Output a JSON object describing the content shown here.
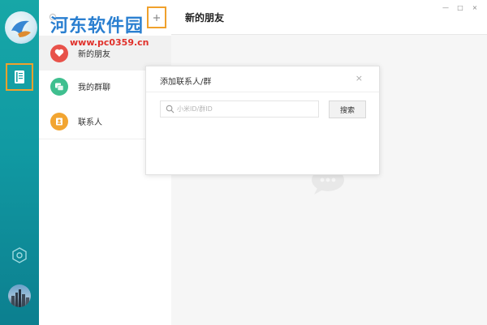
{
  "watermark": {
    "title": "河东软件园",
    "url": "www.pc0359.cn"
  },
  "sidebar": {
    "items": [
      {
        "label": "新的朋友",
        "icon": "heart-icon",
        "color": "#e8524a"
      },
      {
        "label": "我的群聊",
        "icon": "group-chat-icon",
        "color": "#3fbf8f"
      },
      {
        "label": "联系人",
        "icon": "contact-card-icon",
        "color": "#f2a531"
      }
    ]
  },
  "main": {
    "title": "新的朋友"
  },
  "dialog": {
    "title": "添加联系人/群",
    "close": "×",
    "search_placeholder": "小米ID/群ID",
    "search_button": "搜索"
  },
  "window_controls": {
    "minimize": "—",
    "maximize": "□",
    "close": "×"
  },
  "colors": {
    "rail": "#14a0a6",
    "accent_border": "#f0a12c"
  }
}
